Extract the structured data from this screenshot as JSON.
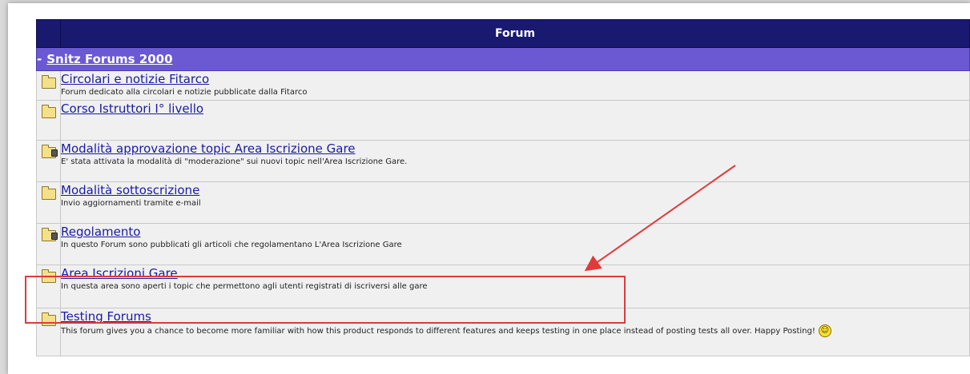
{
  "header": {
    "title": "Forum"
  },
  "category": {
    "toggle": "-",
    "title": "Snitz Forums 2000"
  },
  "forums": [
    {
      "title": "Circolari e notizie Fitarco",
      "description": "Forum dedicato alla circolari e notizie pubblicate dalla Fitarco",
      "icon": "folder-icon"
    },
    {
      "title": "Corso Istruttori I° livello",
      "description": "",
      "icon": "folder-icon"
    },
    {
      "title": "Modalità approvazione topic Area Iscrizione Gare",
      "description": "E' stata attivata la modalità di \"moderazione\" sui nuovi topic nell'Area Iscrizione Gare.",
      "icon": "locked-folder-icon"
    },
    {
      "title": "Modalità sottoscrizione",
      "description": "Invio aggiornamenti tramite e-mail",
      "icon": "folder-icon"
    },
    {
      "title": "Regolamento",
      "description": "In questo Forum sono pubblicati gli articoli che regolamentano L'Area Iscrizione Gare",
      "icon": "locked-folder-icon"
    },
    {
      "title": "Area Iscrizioni Gare",
      "description": "In questa area sono aperti i topic che permettono agli utenti registrati di iscriversi alle gare",
      "icon": "folder-icon"
    },
    {
      "title": "Testing Forums",
      "description": "This forum gives you a chance to become more familiar with how this product responds to different features and keeps testing in one place instead of posting tests all over. Happy Posting!",
      "icon": "folder-icon"
    }
  ],
  "annotation": {
    "color": "#e03a3a"
  },
  "colors": {
    "header": "#191970",
    "category": "#6b59d3",
    "row": "#f0f0f0",
    "link": "#1a1aa6"
  }
}
